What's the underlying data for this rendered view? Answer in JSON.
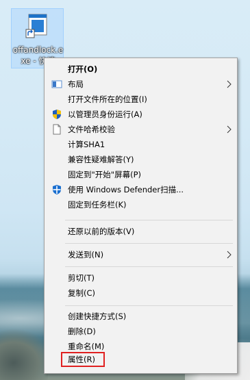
{
  "desktop_icon": {
    "label_line1": "offandlock.e",
    "label_line2": "xe - 快捷",
    "icon": "shortcut-exe-icon"
  },
  "context_menu": {
    "items": [
      {
        "label": "打开(O)",
        "bold": true
      },
      {
        "label": "布局",
        "icon": "layout-icon",
        "submenu": true
      },
      {
        "label": "打开文件所在的位置(I)"
      },
      {
        "label": "以管理员身份运行(A)",
        "icon": "uac-shield-icon"
      },
      {
        "label": "文件哈希校验",
        "icon": "file-icon",
        "submenu": true
      },
      {
        "label": "计算SHA1"
      },
      {
        "label": "兼容性疑难解答(Y)"
      },
      {
        "label": "固定到\"开始\"屏幕(P)"
      },
      {
        "label": "使用 Windows Defender扫描...",
        "icon": "defender-icon"
      },
      {
        "label": "固定到任务栏(K)"
      },
      {
        "label": "还原以前的版本(V)"
      },
      {
        "label": "发送到(N)",
        "submenu": true
      },
      {
        "label": "剪切(T)"
      },
      {
        "label": "复制(C)"
      },
      {
        "label": "创建快捷方式(S)"
      },
      {
        "label": "删除(D)"
      },
      {
        "label": "重命名(M)"
      },
      {
        "label": "属性(R)",
        "highlighted": true
      }
    ]
  },
  "colors": {
    "highlight_border": "#e02020",
    "menu_background": "#f2f2f2",
    "shield_blue": "#1f5fbf",
    "shield_yellow": "#f4c20d",
    "defender_blue": "#1a6fd0"
  }
}
